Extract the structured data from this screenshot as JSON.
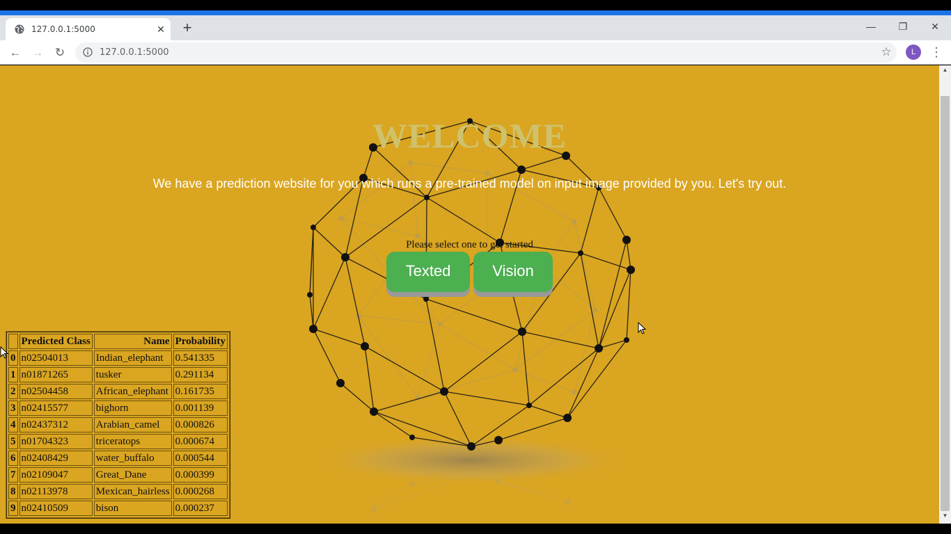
{
  "browser": {
    "tab_title": "127.0.0.1:5000",
    "url": "127.0.0.1:5000",
    "profile_initial": "L",
    "icons": {
      "favicon": "globe-icon",
      "close": "close-icon",
      "new_tab": "plus-icon",
      "minimize": "minimize-icon",
      "restore": "restore-icon",
      "close_window": "close-window-icon",
      "back": "back-arrow-icon",
      "forward": "forward-arrow-icon",
      "reload": "reload-icon",
      "info": "info-icon",
      "bookmark": "star-icon",
      "menu": "kebab-menu-icon"
    },
    "accent_color": "#1a73e8"
  },
  "page": {
    "background_color": "#daa520",
    "welcome": "WELCOME",
    "subtitle": "We have a prediction website for you which runs a pre-trained model on input image provided by you. Let's try out.",
    "prompt": "Please select one to get started",
    "buttons": {
      "texted": "Texted",
      "vision": "Vision"
    },
    "button_color": "#4caf50"
  },
  "table": {
    "headers": [
      "",
      "Predicted Class",
      "Name",
      "Probability"
    ],
    "rows": [
      {
        "idx": "0",
        "cls": "n02504013",
        "name": "Indian_elephant",
        "prob": "0.541335"
      },
      {
        "idx": "1",
        "cls": "n01871265",
        "name": "tusker",
        "prob": "0.291134"
      },
      {
        "idx": "2",
        "cls": "n02504458",
        "name": "African_elephant",
        "prob": "0.161735"
      },
      {
        "idx": "3",
        "cls": "n02415577",
        "name": "bighorn",
        "prob": "0.001139"
      },
      {
        "idx": "4",
        "cls": "n02437312",
        "name": "Arabian_camel",
        "prob": "0.000826"
      },
      {
        "idx": "5",
        "cls": "n01704323",
        "name": "triceratops",
        "prob": "0.000674"
      },
      {
        "idx": "6",
        "cls": "n02408429",
        "name": "water_buffalo",
        "prob": "0.000544"
      },
      {
        "idx": "7",
        "cls": "n02109047",
        "name": "Great_Dane",
        "prob": "0.000399"
      },
      {
        "idx": "8",
        "cls": "n02113978",
        "name": "Mexican_hairless",
        "prob": "0.000268"
      },
      {
        "idx": "9",
        "cls": "n02410509",
        "name": "bison",
        "prob": "0.000237"
      }
    ]
  }
}
